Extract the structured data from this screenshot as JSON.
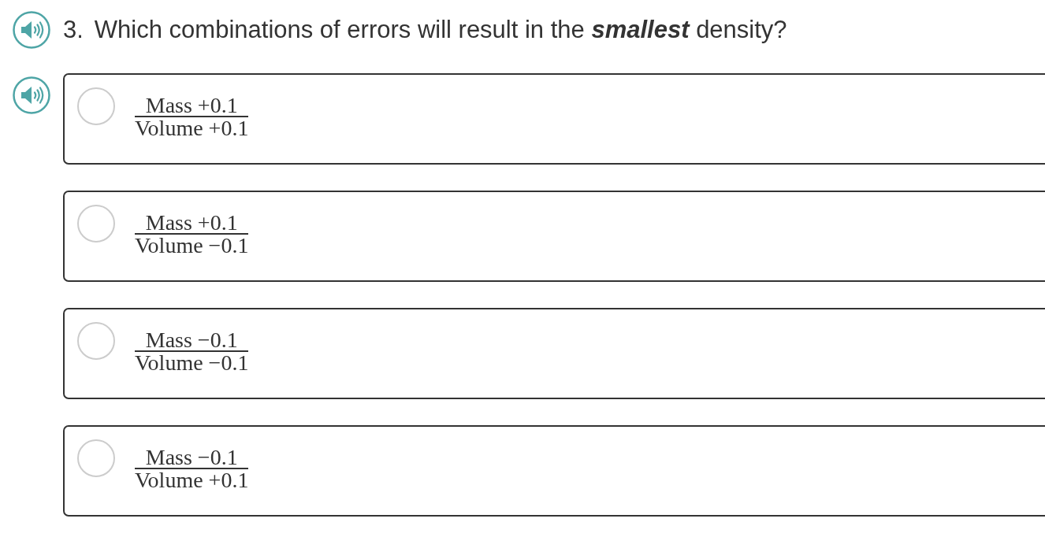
{
  "question": {
    "number": "3.",
    "text": "Which combinations of errors will result in the **smallest** density?"
  },
  "options": [
    {
      "selected": false,
      "numerator": "Mass +0.1",
      "denominator": "Volume +0.1"
    },
    {
      "selected": false,
      "numerator": "Mass +0.1",
      "denominator": "Volume −0.1"
    },
    {
      "selected": false,
      "numerator": "Mass −0.1",
      "denominator": "Volume −0.1"
    },
    {
      "selected": false,
      "numerator": "Mass −0.1",
      "denominator": "Volume +0.1"
    }
  ]
}
